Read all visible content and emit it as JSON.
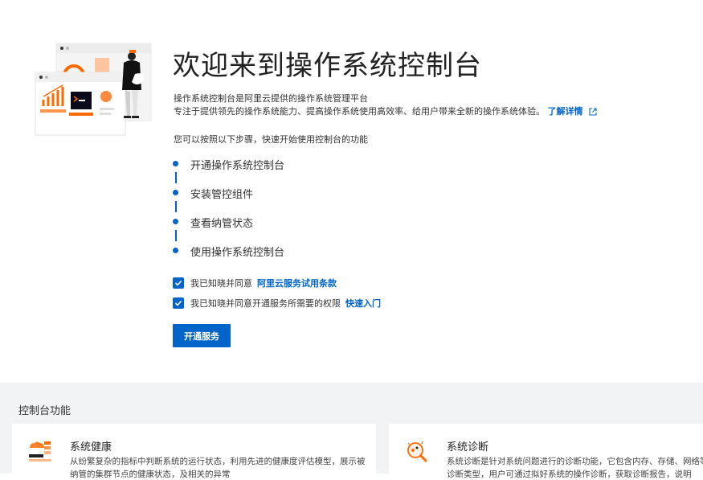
{
  "hero": {
    "title": "欢迎来到操作系统控制台",
    "desc_line1": "操作系统控制台是阿里云提供的操作系统管理平台",
    "desc_line2": "专注于提供领先的操作系统能力、提高操作系统使用高效率、给用户带来全新的操作系统体验。",
    "learn_more": "了解详情",
    "hint": "您可以按照以下步骤，快速开始使用控制台的功能"
  },
  "steps": [
    {
      "label": "开通操作系统控制台"
    },
    {
      "label": "安装管控组件"
    },
    {
      "label": "查看纳管状态"
    },
    {
      "label": "使用操作系统控制台"
    }
  ],
  "agreements": [
    {
      "text": "我已知晓并同意",
      "link": "阿里云服务试用条款",
      "checked": true
    },
    {
      "text": "我已知晓并同意开通服务所需要的权限",
      "link": "快速入门",
      "checked": true
    }
  ],
  "open_button": "开通服务",
  "features": {
    "section_title": "控制台功能",
    "cards": [
      {
        "icon": "health-icon",
        "title": "系统健康",
        "desc": "从纷繁复杂的指标中判断系统的运行状态，利用先进的健康度评估模型，展示被纳管的集群节点的健康状态，及相关的异常"
      },
      {
        "icon": "diagnosis-icon",
        "title": "系统诊断",
        "desc": "系统诊断是针对系统问题进行的诊断功能，它包含内存、存储、网络等诊断类型，用户可通过拟好系统的操作诊断，获取诊断报告，说明"
      }
    ]
  },
  "colors": {
    "primary": "#0064c8",
    "accent_orange": "#ff6a00",
    "section_bg": "#f2f3f5"
  }
}
